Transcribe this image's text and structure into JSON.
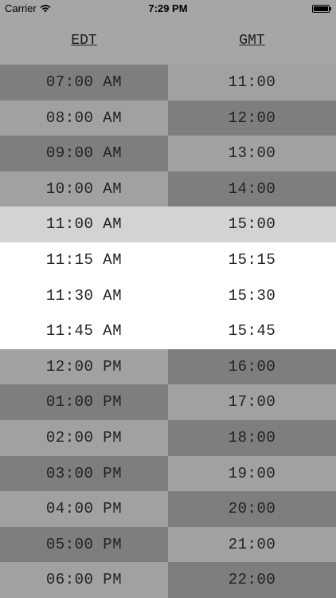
{
  "status_bar": {
    "carrier": "Carrier",
    "time": "7:29 PM"
  },
  "header": {
    "left_zone": "EDT",
    "right_zone": "GMT"
  },
  "rows": [
    {
      "left": "07:00 AM",
      "right": "11:00",
      "style": "alt-a"
    },
    {
      "left": "08:00 AM",
      "right": "12:00",
      "style": "alt-b"
    },
    {
      "left": "09:00 AM",
      "right": "13:00",
      "style": "alt-a"
    },
    {
      "left": "10:00 AM",
      "right": "14:00",
      "style": "alt-b"
    },
    {
      "left": "11:00 AM",
      "right": "15:00",
      "style": "current"
    },
    {
      "left": "11:15 AM",
      "right": "15:15",
      "style": "white"
    },
    {
      "left": "11:30 AM",
      "right": "15:30",
      "style": "white"
    },
    {
      "left": "11:45 AM",
      "right": "15:45",
      "style": "white"
    },
    {
      "left": "12:00 PM",
      "right": "16:00",
      "style": "alt-b"
    },
    {
      "left": "01:00 PM",
      "right": "17:00",
      "style": "alt-a"
    },
    {
      "left": "02:00 PM",
      "right": "18:00",
      "style": "alt-b"
    },
    {
      "left": "03:00 PM",
      "right": "19:00",
      "style": "alt-a"
    },
    {
      "left": "04:00 PM",
      "right": "20:00",
      "style": "alt-b"
    },
    {
      "left": "05:00 PM",
      "right": "21:00",
      "style": "alt-a"
    },
    {
      "left": "06:00 PM",
      "right": "22:00",
      "style": "alt-b"
    }
  ],
  "icons": {
    "wifi": "wifi-icon",
    "battery": "battery-icon"
  },
  "colors": {
    "dark_cell": "#7e7e7e",
    "light_cell": "#a1a1a1",
    "current_row": "#d3d3d3",
    "expanded_row": "#ffffff",
    "header": "#a6a6a6"
  }
}
